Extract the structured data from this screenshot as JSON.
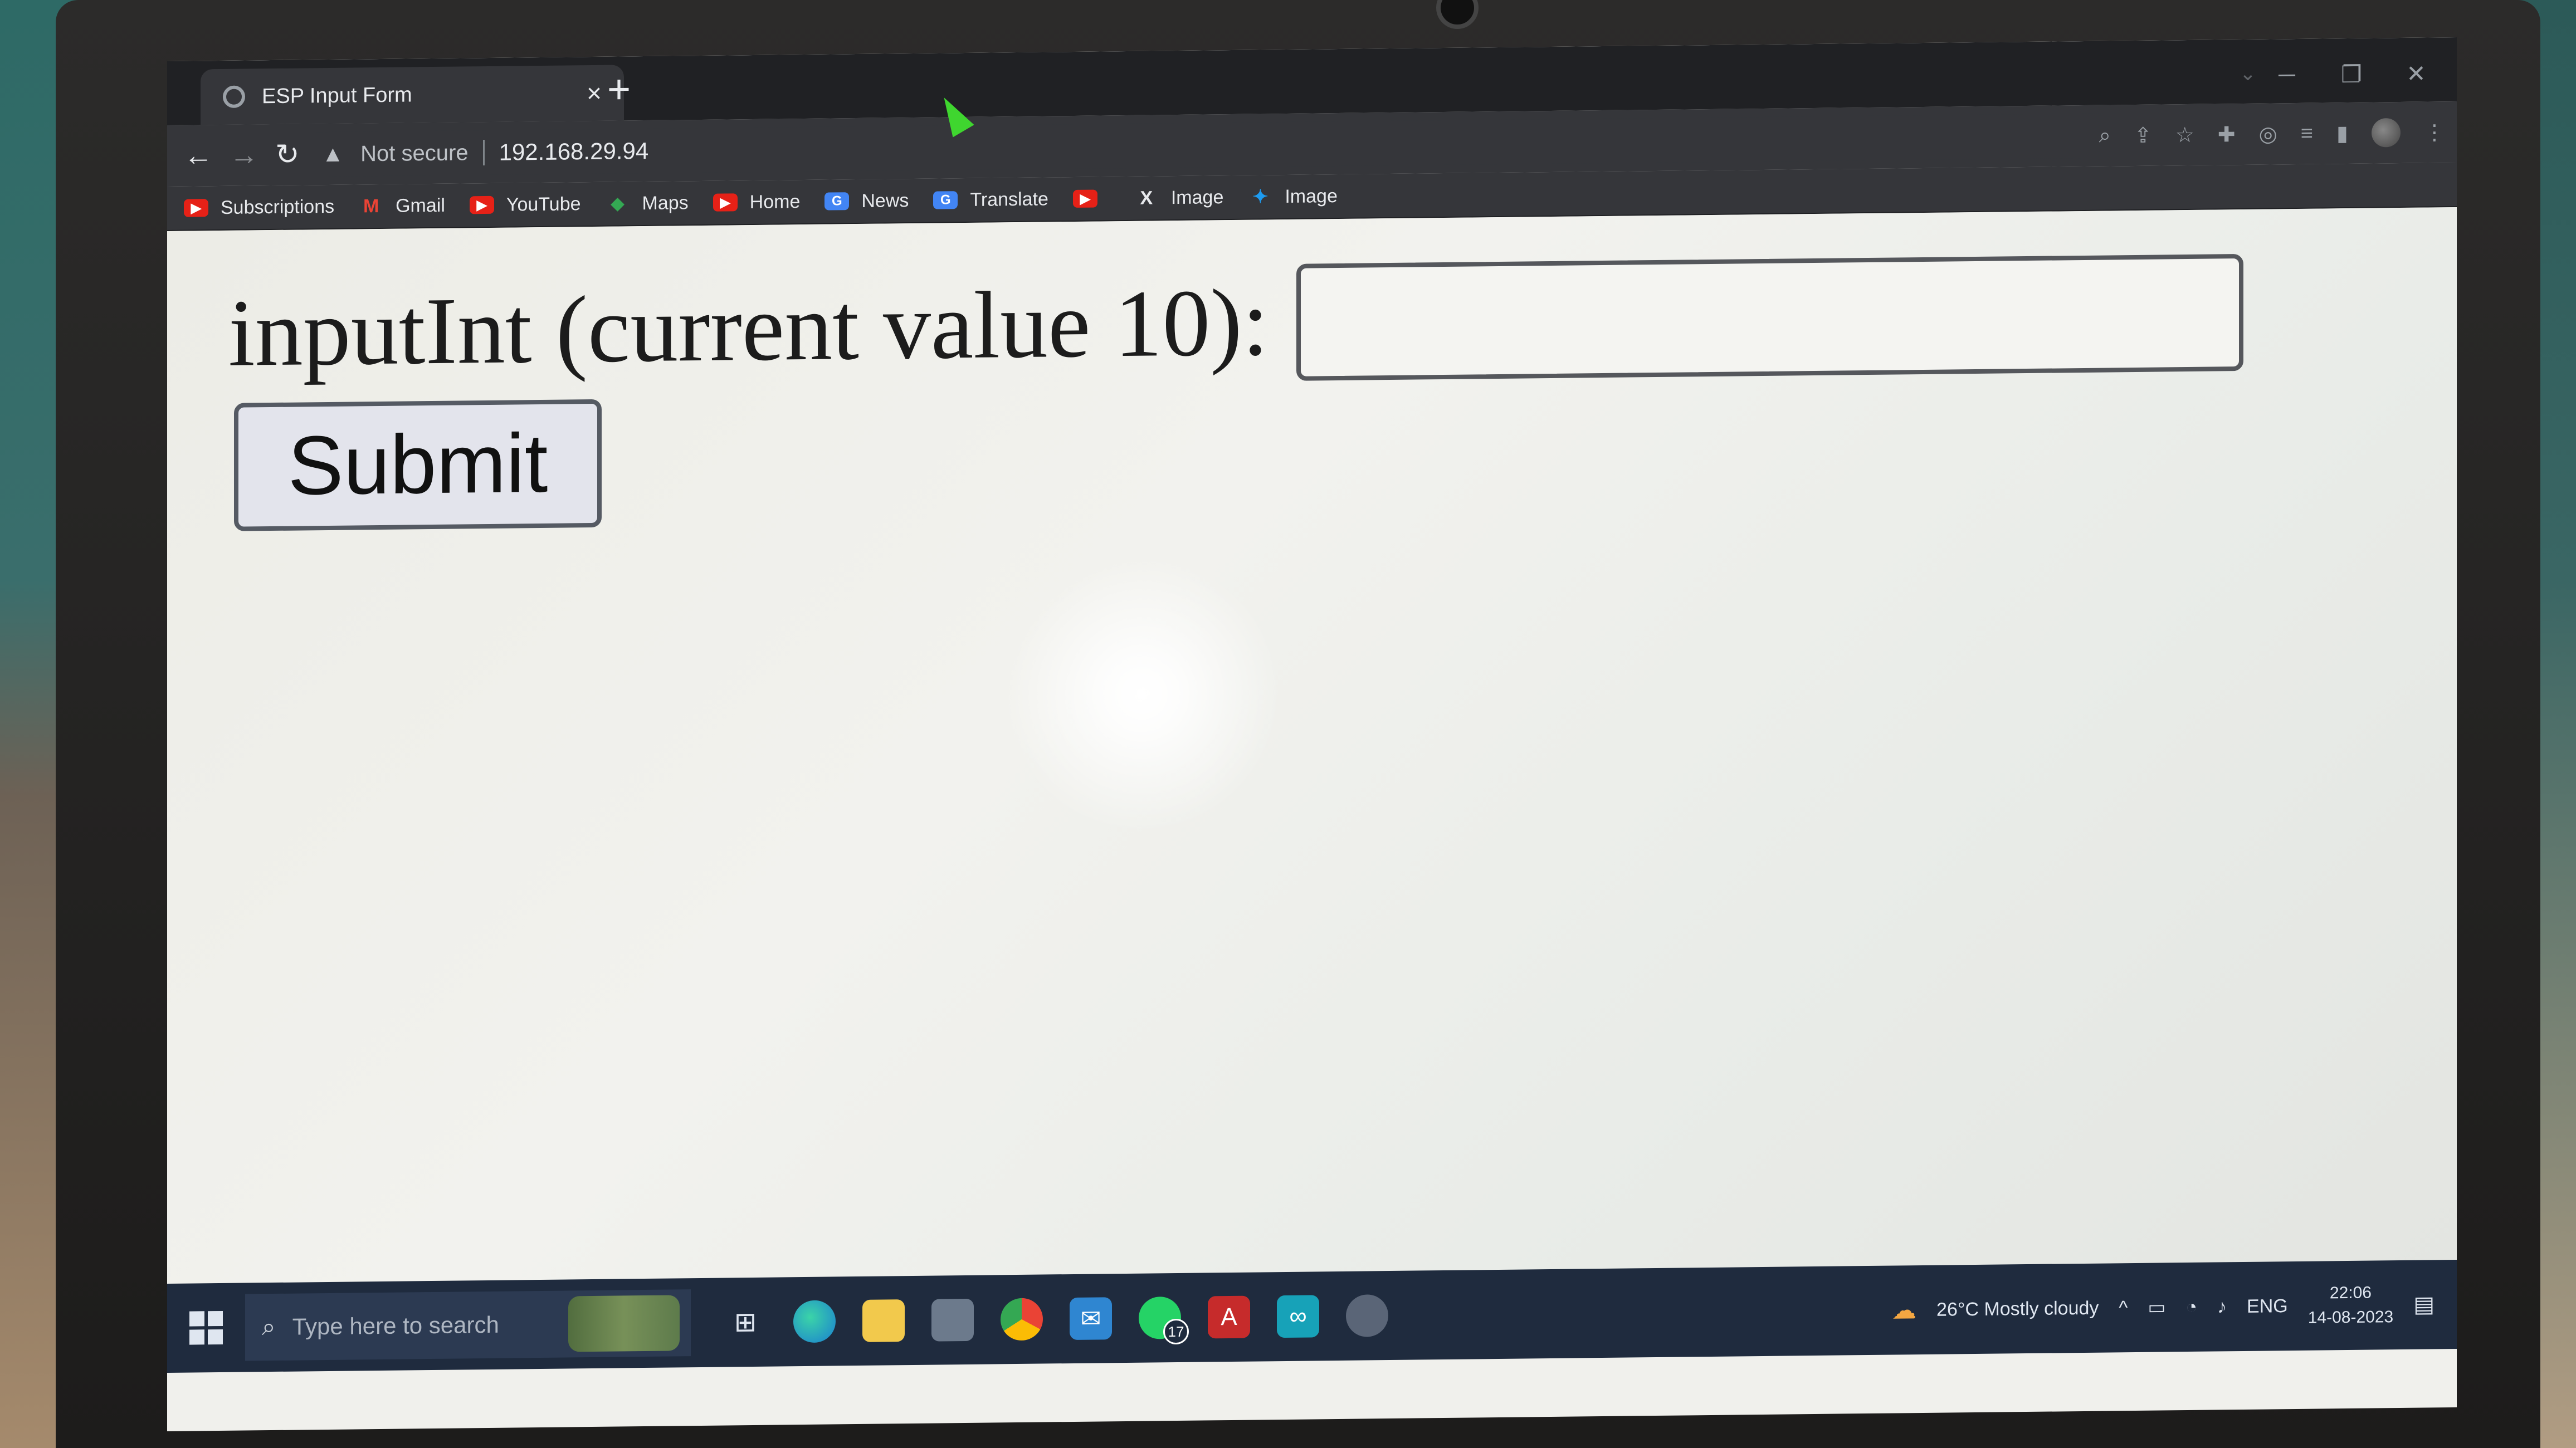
{
  "browser": {
    "tab_title": "ESP Input Form",
    "tab_close": "×",
    "new_tab": "+",
    "security_label": "Not secure",
    "url": "192.168.29.94",
    "bookmarks": [
      {
        "label": "Subscriptions",
        "icon": "youtube-icon"
      },
      {
        "label": "Gmail",
        "icon": "gmail-icon"
      },
      {
        "label": "YouTube",
        "icon": "youtube-icon"
      },
      {
        "label": "Maps",
        "icon": "maps-icon"
      },
      {
        "label": "Home",
        "icon": "youtube-icon"
      },
      {
        "label": "News",
        "icon": "news-icon"
      },
      {
        "label": "Translate",
        "icon": "translate-icon"
      },
      {
        "label": "",
        "icon": "youtube-icon"
      },
      {
        "label": "Image",
        "icon": "x-icon"
      },
      {
        "label": "Image",
        "icon": "twitter-icon"
      }
    ]
  },
  "page": {
    "label": "inputInt (current value 10):",
    "input_value": "",
    "submit_label": "Submit"
  },
  "taskbar": {
    "search_placeholder": "Type here to search",
    "whatsapp_badge": "17",
    "weather": "26°C  Mostly cloudy",
    "language": "ENG",
    "time": "22:06",
    "date": "14-08-2023"
  }
}
